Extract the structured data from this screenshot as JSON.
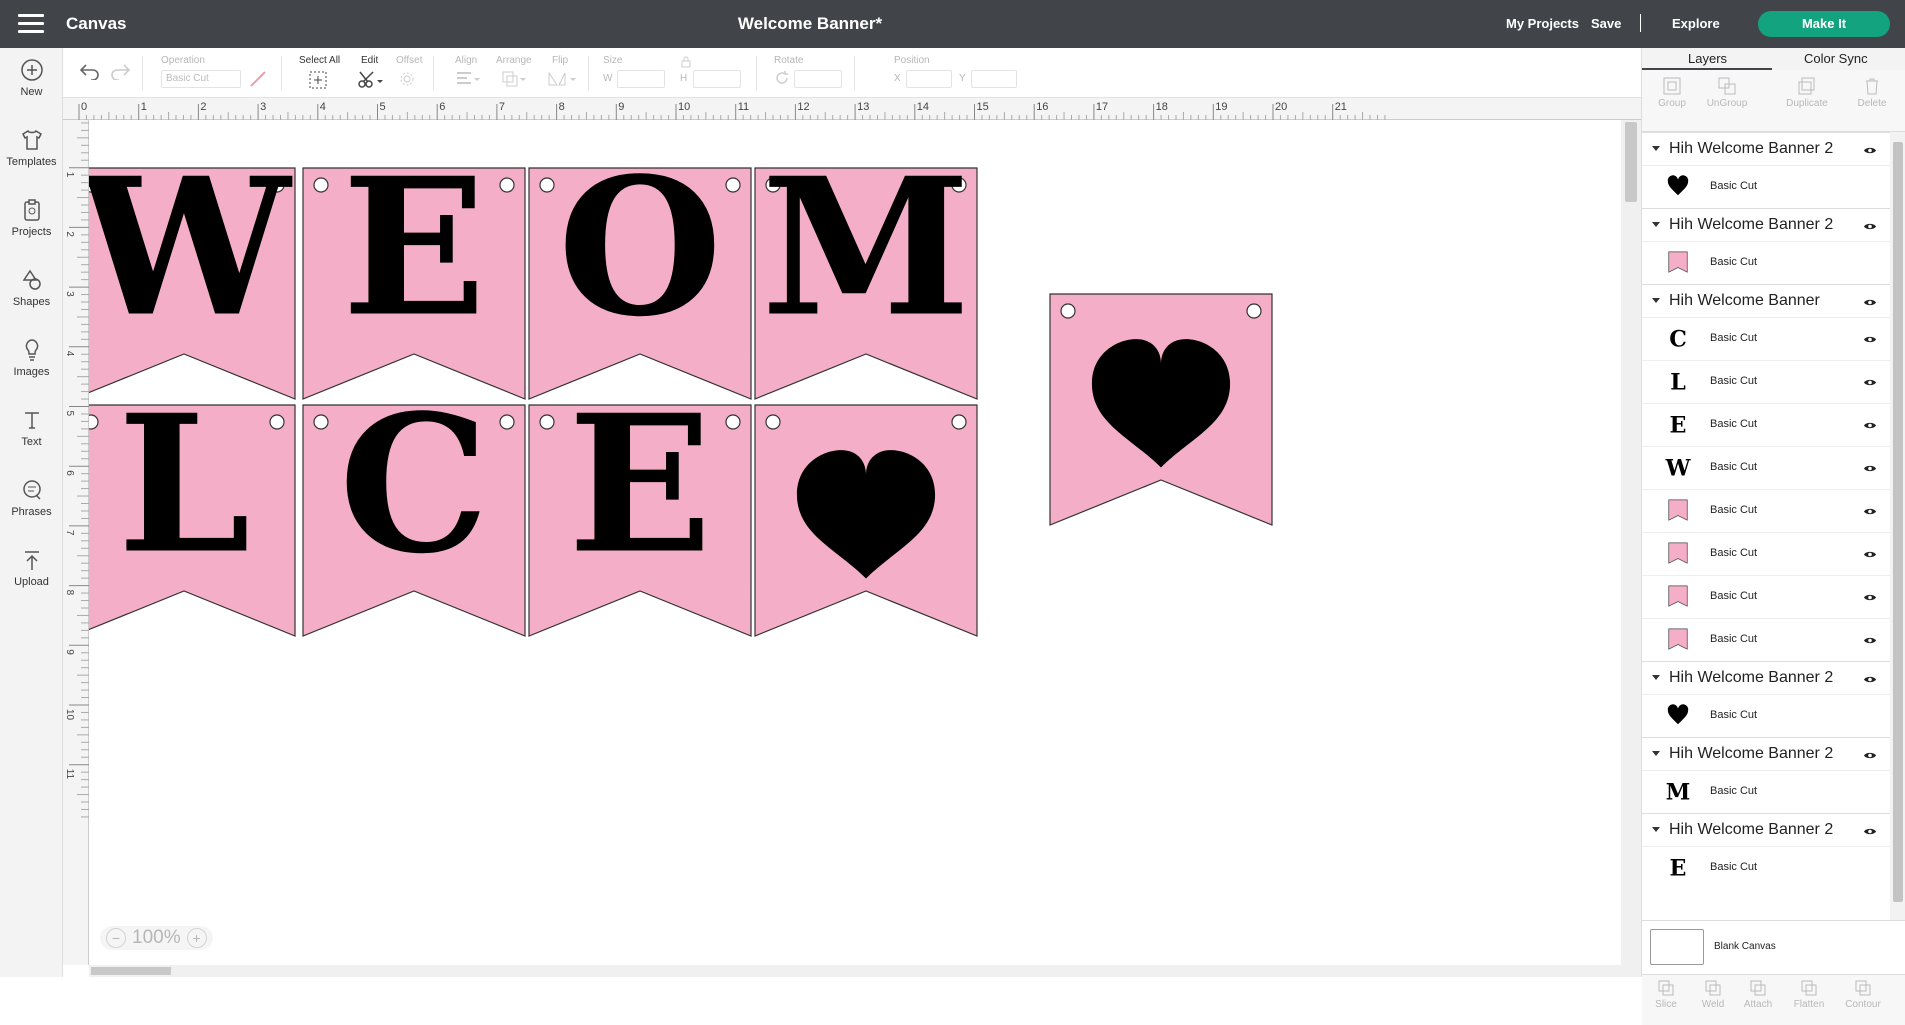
{
  "topbar": {
    "app_title": "Canvas",
    "doc_title": "Welcome Banner*",
    "my_projects": "My Projects",
    "save": "Save",
    "separator": "|",
    "explore": "Explore",
    "make_it": "Make It",
    "make_it_color": "#14a37f"
  },
  "leftbar": {
    "items": [
      {
        "label": "New",
        "icon": "plus-circle-icon"
      },
      {
        "label": "Templates",
        "icon": "shirt-icon"
      },
      {
        "label": "Projects",
        "icon": "clipboard-icon"
      },
      {
        "label": "Shapes",
        "icon": "shapes-icon"
      },
      {
        "label": "Images",
        "icon": "lightbulb-icon"
      },
      {
        "label": "Text",
        "icon": "text-t-icon"
      },
      {
        "label": "Phrases",
        "icon": "speech-bubble-icon"
      },
      {
        "label": "Upload",
        "icon": "upload-icon"
      }
    ]
  },
  "toolbar": {
    "operation_label": "Operation",
    "operation_value": "Basic Cut",
    "select_all": "Select All",
    "edit": "Edit",
    "offset": "Offset",
    "align": "Align",
    "arrange": "Arrange",
    "flip": "Flip",
    "size": "Size",
    "w": "W",
    "h": "H",
    "rotate": "Rotate",
    "position": "Position",
    "x": "X",
    "y": "Y"
  },
  "ruler": {
    "top_ticks": [
      "0",
      "1",
      "2",
      "3",
      "4",
      "5",
      "6",
      "7",
      "8",
      "9",
      "10",
      "11",
      "12",
      "13",
      "14",
      "15",
      "16",
      "17",
      "18",
      "19",
      "20",
      "21"
    ],
    "left_ticks": [
      "0",
      "1",
      "2",
      "3",
      "4",
      "5",
      "6",
      "7",
      "8",
      "9",
      "10",
      "11"
    ]
  },
  "canvas": {
    "pennant_color": "#f4aec8",
    "row1_letters": [
      "W",
      "E",
      "O",
      "M"
    ],
    "row2_letters": [
      "L",
      "C",
      "E",
      "heart"
    ],
    "standalone": "heart",
    "zoom": "100%"
  },
  "rightpanel": {
    "tabs": [
      "Layers",
      "Color Sync"
    ],
    "actions": [
      "Group",
      "UnGroup",
      "Duplicate",
      "Delete"
    ],
    "layers": [
      {
        "group": "Hih Welcome Banner 2",
        "children": [
          {
            "thumb": "heart",
            "name": "Basic Cut"
          }
        ]
      },
      {
        "group": "Hih Welcome Banner 2",
        "children": [
          {
            "thumb": "pennant",
            "name": "Basic Cut"
          }
        ]
      },
      {
        "group": "Hih Welcome Banner",
        "children": [
          {
            "thumb": "C",
            "name": "Basic Cut"
          },
          {
            "thumb": "L",
            "name": "Basic Cut"
          },
          {
            "thumb": "E",
            "name": "Basic Cut"
          },
          {
            "thumb": "W",
            "name": "Basic Cut"
          },
          {
            "thumb": "pennant",
            "name": "Basic Cut"
          },
          {
            "thumb": "pennant",
            "name": "Basic Cut"
          },
          {
            "thumb": "pennant",
            "name": "Basic Cut"
          },
          {
            "thumb": "pennant",
            "name": "Basic Cut"
          }
        ]
      },
      {
        "group": "Hih Welcome Banner 2",
        "children": [
          {
            "thumb": "heart",
            "name": "Basic Cut"
          }
        ]
      },
      {
        "group": "Hih Welcome Banner 2",
        "children": [
          {
            "thumb": "M",
            "name": "Basic Cut"
          }
        ]
      },
      {
        "group": "Hih Welcome Banner 2",
        "children": [
          {
            "thumb": "E",
            "name": "Basic Cut"
          }
        ]
      }
    ],
    "blank_canvas": "Blank Canvas",
    "bottom_actions": [
      "Slice",
      "Weld",
      "Attach",
      "Flatten",
      "Contour"
    ]
  }
}
